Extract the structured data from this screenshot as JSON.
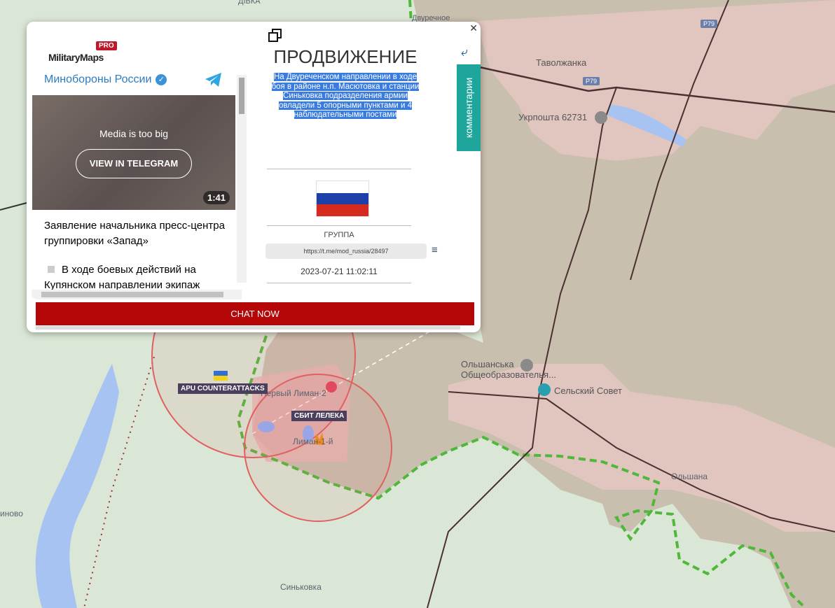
{
  "map": {
    "labels": {
      "tavolzhanka": "Таволжанка",
      "ukrposhta": "Укрпошта 62731",
      "olshanska": "Ольшанська\nОбщеобразователья...",
      "selsky": "Сельский Совет",
      "olshana": "Ольшана",
      "sinkovka": "Синьковка",
      "inovo": "иново",
      "dvurechnoe": "Двуречное",
      "divivka": "ДІВКА",
      "perviy_liman": "Первый Лиман-2",
      "liman_1": "Лиман-1-й"
    },
    "road_shields": [
      "P79",
      "P79"
    ],
    "tags": {
      "apu": "APU COUNTERATTACKS",
      "sbit": "СБИТ ЛЕЛЕКА"
    }
  },
  "popup": {
    "logo": "MilitaryMaps",
    "logo_badge": "PRO",
    "telegram": {
      "channel": "Минобороны России",
      "media_message": "Media is too big",
      "view_button": "VIEW IN TELEGRAM",
      "duration": "1:41",
      "post_text": "Заявление начальника пресс-центра группировки «Запад»",
      "bullet_text": "В ходе боевых действий на Купянском направлении экипаж"
    },
    "title": "ПРОДВИЖЕНИЕ",
    "description": "На Двуреченском направлении в ходе боя в районе н.п. Масютовка и станции Синьковка подразделения армии овладели 5 опорными пунктами и 4 наблюдательными постами",
    "group_label": "ГРУППА",
    "link": "https://t.me/mod_russia/28497",
    "date": "2023-07-21 11:02:11",
    "comments_tab": "комментарии",
    "chat_button": "CHAT NOW",
    "flag_colors": [
      "#ffffff",
      "#1c3fa8",
      "#d52b1e"
    ]
  }
}
